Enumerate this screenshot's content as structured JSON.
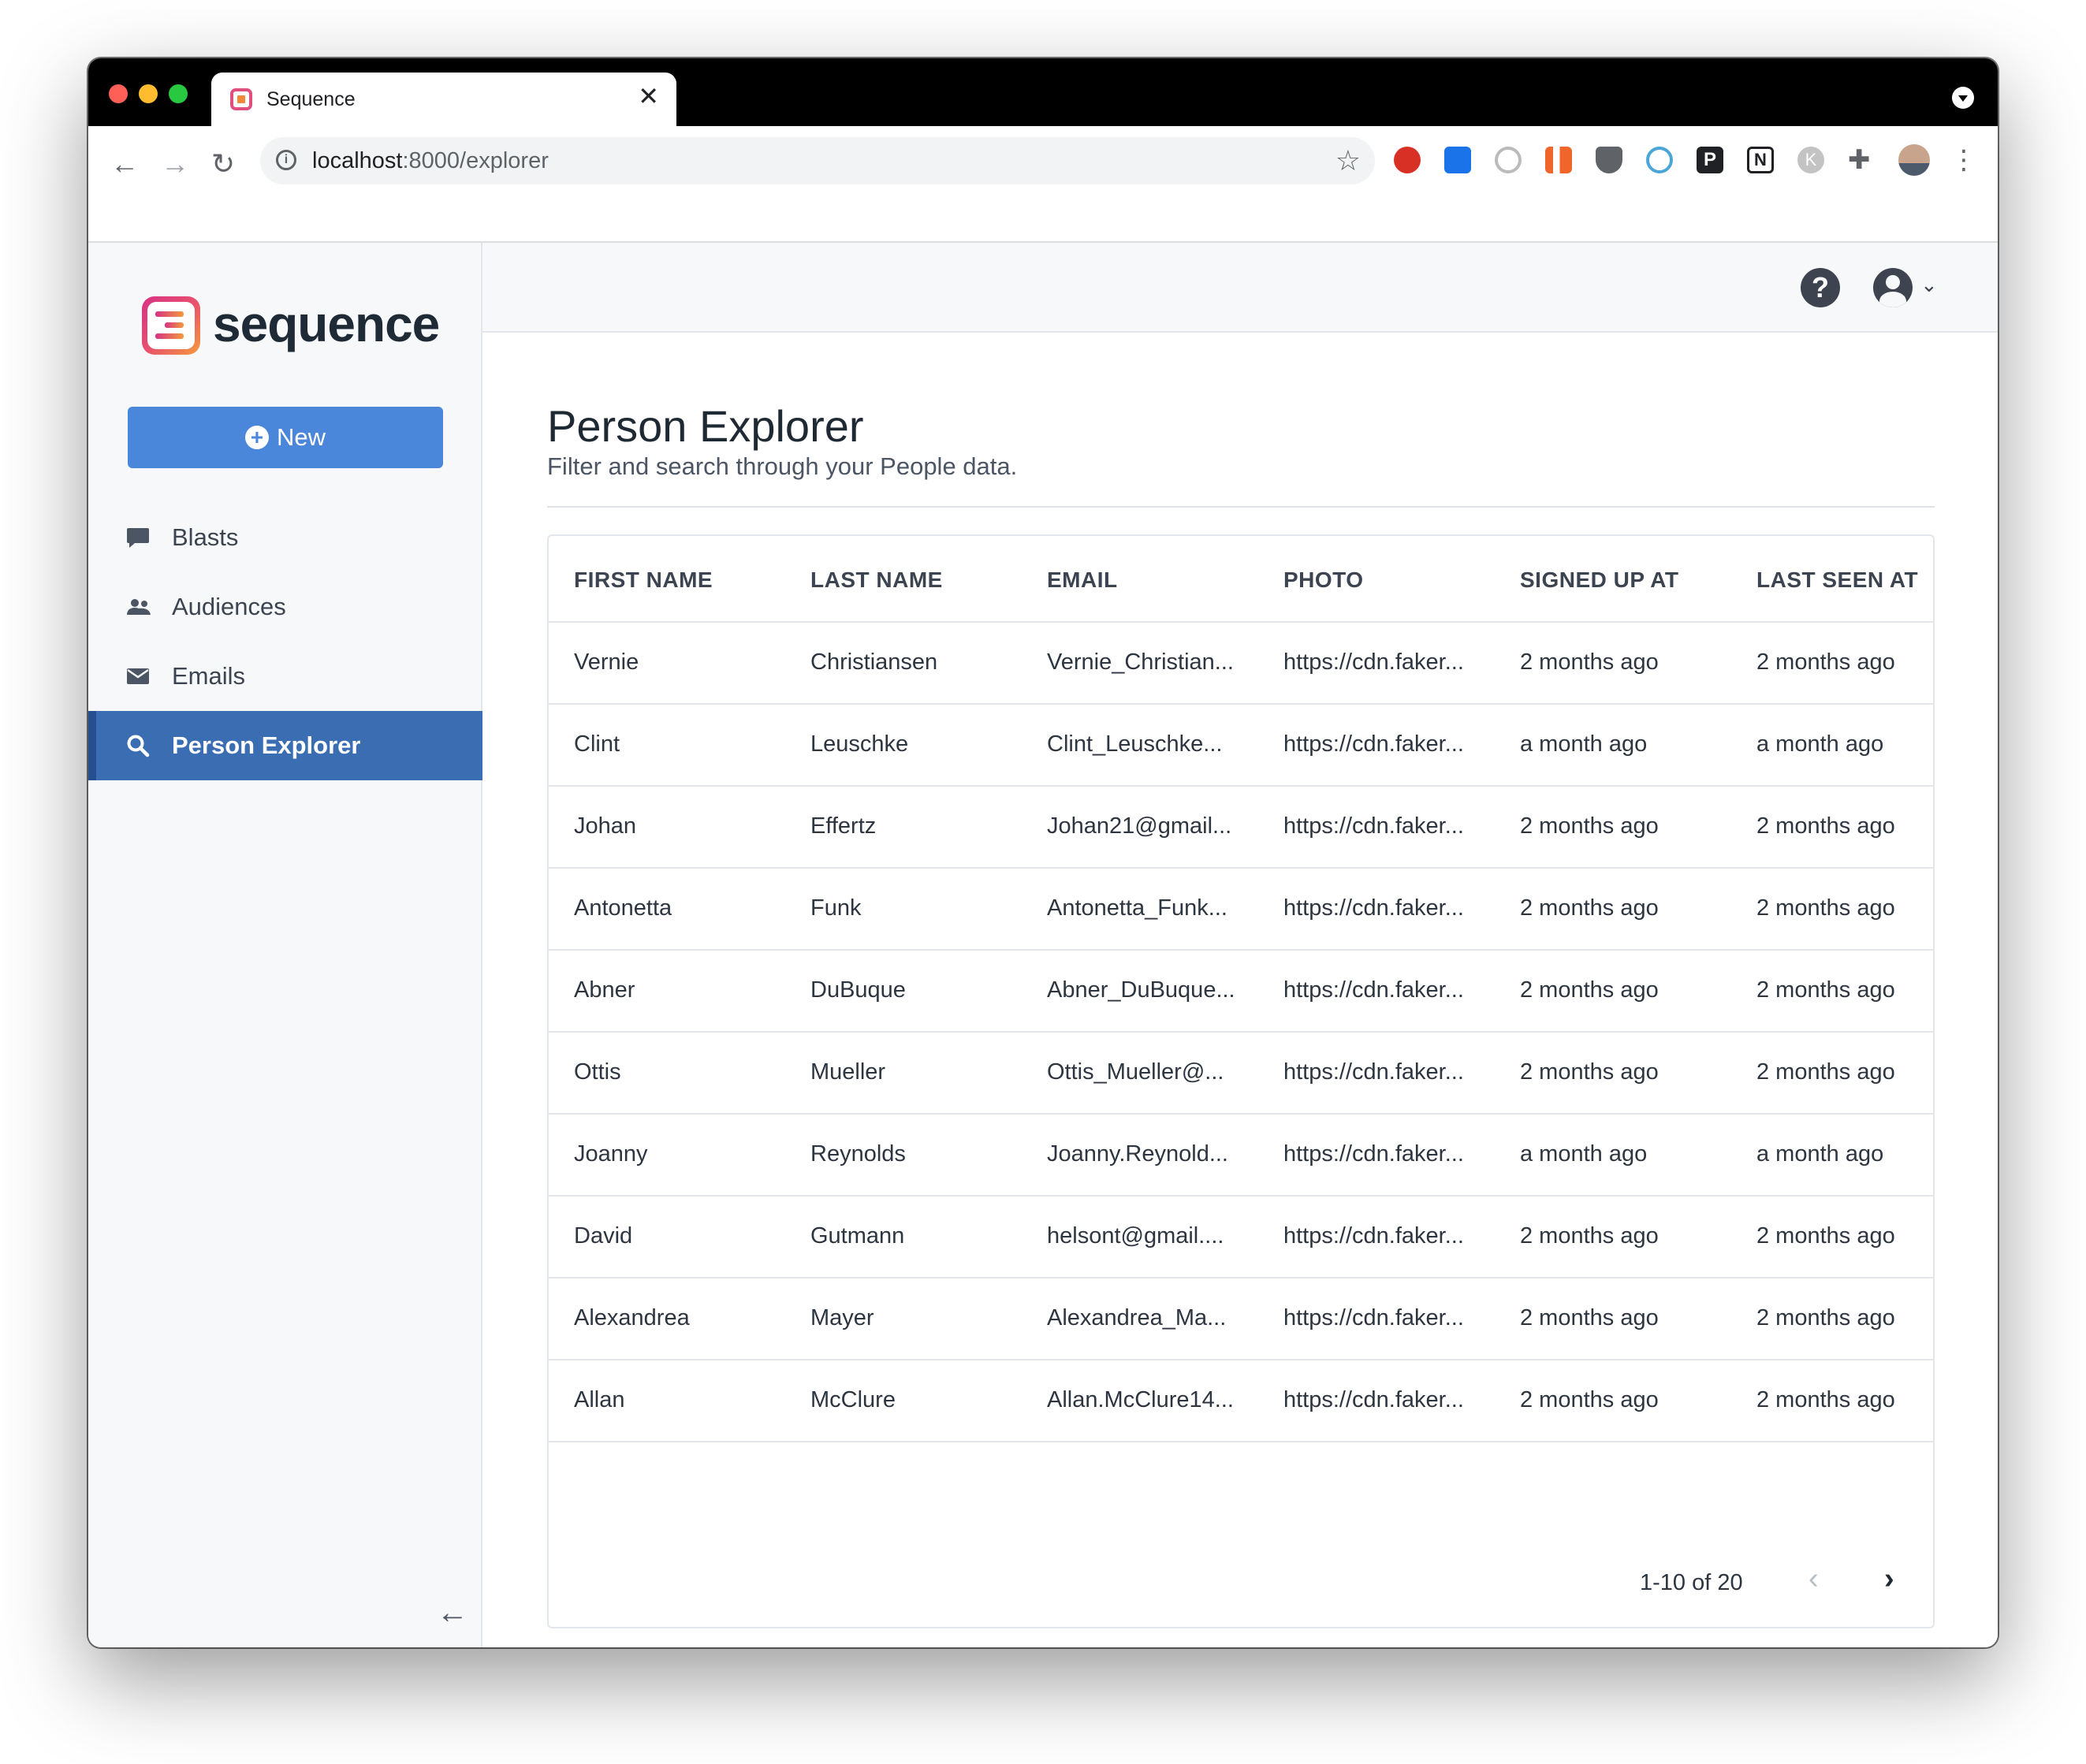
{
  "browser": {
    "tab_title": "Sequence",
    "tab_close_icon": "close-icon",
    "new_tab_icon": "plus-icon",
    "url_host": "localhost",
    "url_path": ":8000/explorer",
    "extensions": [
      "adblock-icon",
      "download-icon",
      "privacy-icon",
      "stats-icon",
      "ublock-icon",
      "network-icon",
      "producthunt-icon",
      "notion-icon",
      "k-icon",
      "puzzle-icon",
      "profile-avatar"
    ]
  },
  "sidebar": {
    "brand": "sequence",
    "new_button": "New",
    "items": [
      {
        "label": "Blasts",
        "icon": "comment-icon",
        "active": false
      },
      {
        "label": "Audiences",
        "icon": "users-icon",
        "active": false
      },
      {
        "label": "Emails",
        "icon": "envelope-icon",
        "active": false
      },
      {
        "label": "Person Explorer",
        "icon": "search-icon",
        "active": true
      }
    ],
    "collapse_icon": "arrow-left-icon"
  },
  "header": {
    "help_icon": "question-circle-icon",
    "user_icon": "user-circle-icon",
    "help_glyph": "?"
  },
  "page": {
    "title": "Person Explorer",
    "subtitle": "Filter and search through your People data."
  },
  "table": {
    "columns": [
      "FIRST NAME",
      "LAST NAME",
      "EMAIL",
      "PHOTO",
      "SIGNED UP AT",
      "LAST SEEN AT"
    ],
    "rows": [
      [
        "Vernie",
        "Christiansen",
        "Vernie_Christian...",
        "https://cdn.faker...",
        "2 months ago",
        "2 months ago"
      ],
      [
        "Clint",
        "Leuschke",
        "Clint_Leuschke...",
        "https://cdn.faker...",
        "a month ago",
        "a month ago"
      ],
      [
        "Johan",
        "Effertz",
        "Johan21@gmail...",
        "https://cdn.faker...",
        "2 months ago",
        "2 months ago"
      ],
      [
        "Antonetta",
        "Funk",
        "Antonetta_Funk...",
        "https://cdn.faker...",
        "2 months ago",
        "2 months ago"
      ],
      [
        "Abner",
        "DuBuque",
        "Abner_DuBuque...",
        "https://cdn.faker...",
        "2 months ago",
        "2 months ago"
      ],
      [
        "Ottis",
        "Mueller",
        "Ottis_Mueller@...",
        "https://cdn.faker...",
        "2 months ago",
        "2 months ago"
      ],
      [
        "Joanny",
        "Reynolds",
        "Joanny.Reynold...",
        "https://cdn.faker...",
        "a month ago",
        "a month ago"
      ],
      [
        "David",
        "Gutmann",
        "helsont@gmail....",
        "https://cdn.faker...",
        "2 months ago",
        "2 months ago"
      ],
      [
        "Alexandrea",
        "Mayer",
        "Alexandrea_Ma...",
        "https://cdn.faker...",
        "2 months ago",
        "2 months ago"
      ],
      [
        "Allan",
        "McClure",
        "Allan.McClure14...",
        "https://cdn.faker...",
        "2 months ago",
        "2 months ago"
      ]
    ]
  },
  "pagination": {
    "label": "1-10 of 20",
    "prev_icon": "chevron-left-icon",
    "next_icon": "chevron-right-icon"
  },
  "colors": {
    "primary_button": "#4a86d9",
    "active_nav": "#3b6db3",
    "sidebar_bg": "#f7f8fa"
  }
}
